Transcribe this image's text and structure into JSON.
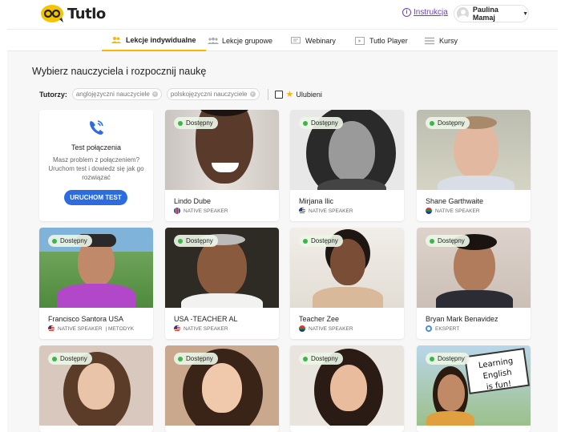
{
  "header": {
    "logo_text": "Tutlo",
    "instruction_link": "Instrukcja",
    "user_name": "Paulina Mamaj"
  },
  "nav": {
    "tabs": [
      {
        "label": "Lekcje indywidualne",
        "active": true
      },
      {
        "label": "Lekcje grupowe",
        "active": false
      },
      {
        "label": "Webinary",
        "active": false
      },
      {
        "label": "Tutlo Player",
        "active": false
      },
      {
        "label": "Kursy",
        "active": false
      }
    ]
  },
  "page": {
    "title": "Wybierz nauczyciela i rozpocznij naukę",
    "filters_label": "Tutorzy:",
    "filter_chips": [
      "anglojęzyczni nauczyciele",
      "polskojęzyczni nauczyciele"
    ],
    "favorites_label": "Ulubieni"
  },
  "test_card": {
    "title": "Test połączenia",
    "description": "Masz problem z połączeniem? Uruchom test i dowiedz się jak go rozwiązać",
    "button": "URUCHOM TEST"
  },
  "status_label": "Dostępny",
  "tutors": [
    {
      "name": "Lindo Dube",
      "tag": "NATIVE SPEAKER",
      "flag": "uk",
      "tag2": ""
    },
    {
      "name": "Mirjana Ilic",
      "tag": "NATIVE SPEAKER",
      "flag": "us",
      "tag2": ""
    },
    {
      "name": "Shane Garthwaite",
      "tag": "NATIVE SPEAKER",
      "flag": "za",
      "tag2": ""
    },
    {
      "name": "Francisco Santora USA",
      "tag": "NATIVE SPEAKER",
      "flag": "us",
      "tag2": "METODYK"
    },
    {
      "name": "USA -TEACHER AL",
      "tag": "NATIVE SPEAKER",
      "flag": "us",
      "tag2": ""
    },
    {
      "name": "Teacher Zee",
      "tag": "NATIVE SPEAKER",
      "flag": "za",
      "tag2": ""
    },
    {
      "name": "Bryan Mark Benavidez",
      "tag": "EKSPERT",
      "flag": "ex",
      "tag2": ""
    }
  ],
  "sign_text": [
    "Learning English",
    "is fun!"
  ]
}
